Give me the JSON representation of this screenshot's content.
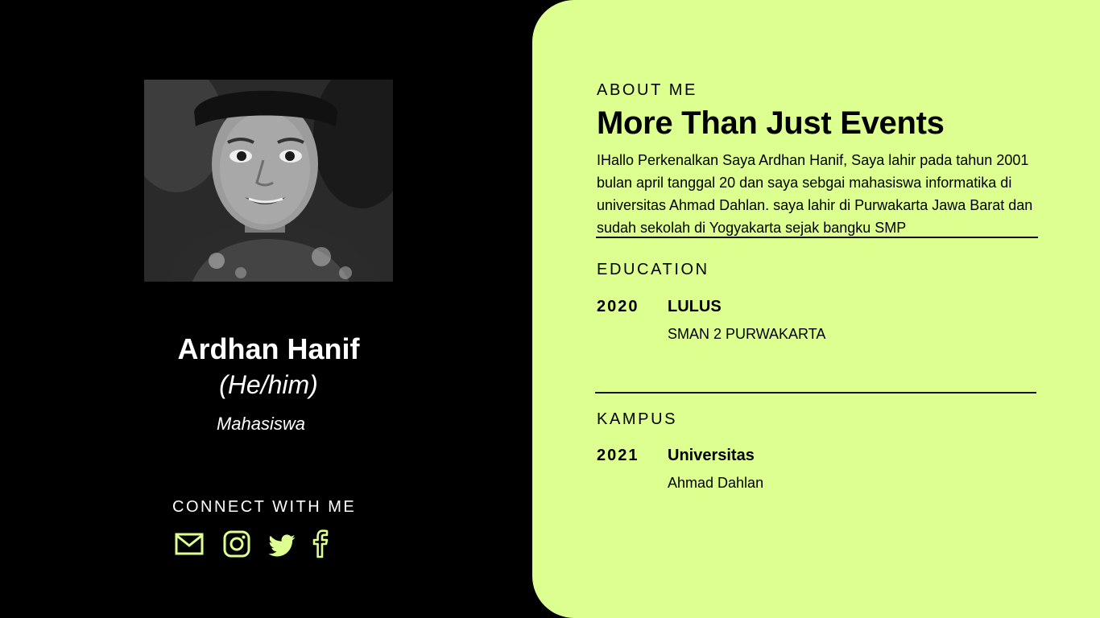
{
  "colors": {
    "background": "#000000",
    "card": "#ddff8f",
    "accent": "#ddff8f",
    "text_dark": "#000000",
    "text_light": "#ffffff"
  },
  "profile": {
    "photo_icon": "profile-photo-grayscale",
    "name": "Ardhan Hanif",
    "pronouns": "(He/him)",
    "role": "Mahasiswa"
  },
  "connect": {
    "heading": "CONNECT WITH ME",
    "icons": [
      "mail-icon",
      "instagram-icon",
      "twitter-icon",
      "facebook-icon"
    ]
  },
  "about": {
    "label": "ABOUT ME",
    "headline": "More Than Just Events",
    "bio": "IHallo Perkenalkan Saya Ardhan Hanif, Saya lahir pada tahun 2001 bulan april tanggal 20 dan saya sebgai mahasiswa informatika di universitas Ahmad Dahlan. saya lahir di Purwakarta Jawa Barat dan sudah sekolah di Yogyakarta sejak bangku SMP"
  },
  "education": {
    "label": "EDUCATION",
    "year": "2020",
    "title": "LULUS",
    "subtitle": "SMAN 2 PURWAKARTA"
  },
  "kampus": {
    "label": "KAMPUS",
    "year": "2021",
    "title": "Universitas",
    "subtitle": "Ahmad Dahlan"
  }
}
